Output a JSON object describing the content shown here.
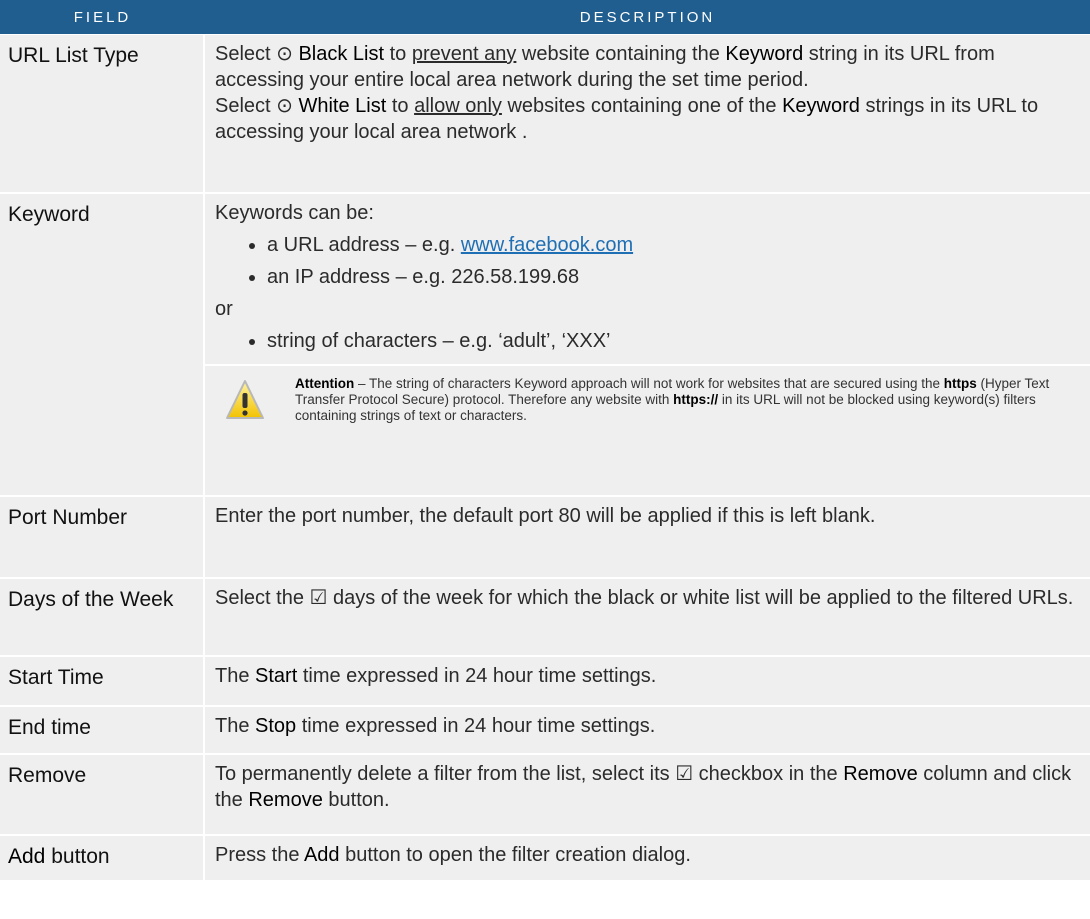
{
  "header": {
    "field": "FIELD",
    "description": "DESCRIPTION"
  },
  "rows": {
    "url_list_type": {
      "field": "URL List Type",
      "p1_a": "Select ⊙ ",
      "p1_b": "Black List",
      "p1_c": " to ",
      "p1_d": "prevent any",
      "p1_e": " website containing the ",
      "p1_f": "Keyword",
      "p1_g": " string in its URL from accessing your entire local area network during the set time period.",
      "p2_a": "Select ⊙ ",
      "p2_b": "White List",
      "p2_c": " to ",
      "p2_d": "allow only",
      "p2_e": " websites containing one of the ",
      "p2_f": "Keyword",
      "p2_g": " strings in its URL to accessing your local area network ."
    },
    "keyword": {
      "field": "Keyword",
      "intro": "Keywords can be:",
      "b1_a": "a URL address – e.g. ",
      "b1_link": "www.facebook.com",
      "b2": "an IP address – e.g. 226.58.199.68",
      "or": "or",
      "b3": "string of characters – e.g. ‘adult’, ‘XXX’",
      "attn_a": "Attention",
      "attn_b": " – The string of characters Keyword approach will not work for websites that are secured using the ",
      "attn_c": "https",
      "attn_d": " (Hyper Text Transfer Protocol Secure) protocol. Therefore any website with ",
      "attn_e": "https://",
      "attn_f": " in its URL will not be blocked using keyword(s) filters containing strings of text or characters."
    },
    "port_number": {
      "field": "Port Number",
      "desc": "Enter the port number, the default port 80 will be applied if this is left blank."
    },
    "days_of_week": {
      "field": "Days of the Week",
      "desc": "Select the ☑ days of the week for which the black or white list will be applied to the filtered URLs."
    },
    "start_time": {
      "field": "Start Time",
      "a": "The ",
      "b": "Start",
      "c": " time expressed in 24 hour time settings."
    },
    "end_time": {
      "field": "End time",
      "a": "The ",
      "b": "Stop",
      "c": " time expressed in 24 hour time settings."
    },
    "remove": {
      "field": "Remove",
      "a": "To permanently delete a filter from the list, select its ☑ checkbox in the ",
      "b": "Remove",
      "c": " column and click the ",
      "d": "Remove",
      "e": " button."
    },
    "add_button": {
      "field_a": "Add",
      "field_b": " button",
      "a": "Press the ",
      "b": "Add",
      "c": " button to open the filter creation dialog."
    }
  },
  "colors": {
    "header_bg": "#1f5e8e",
    "row_bg": "#efefef",
    "link": "#1f6fb5"
  },
  "icons": {
    "attention": "warning-triangle-icon"
  }
}
